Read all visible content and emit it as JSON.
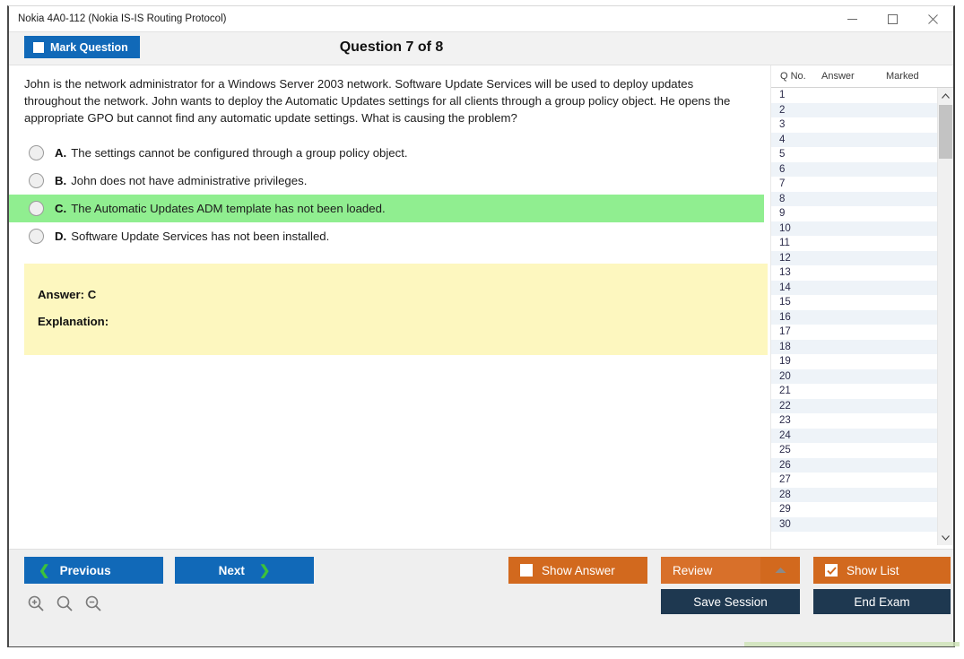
{
  "window": {
    "title": "Nokia 4A0-112 (Nokia IS-IS Routing Protocol)",
    "minimize_label": "minimize",
    "maximize_label": "maximize",
    "close_label": "close"
  },
  "header": {
    "mark_question_label": "Mark Question",
    "question_title": "Question 7 of 8"
  },
  "question": {
    "text": "John is the network administrator for a Windows Server 2003 network. Software Update Services will be used to deploy updates throughout the network. John wants to deploy the Automatic Updates settings for all clients through a group policy object. He opens the appropriate GPO but cannot find any automatic update settings. What is causing the problem?",
    "options": [
      {
        "letter": "A.",
        "text": "The settings cannot be configured through a group policy object.",
        "correct": false
      },
      {
        "letter": "B.",
        "text": "John does not have administrative privileges.",
        "correct": false
      },
      {
        "letter": "C.",
        "text": "The Automatic Updates ADM template has not been loaded.",
        "correct": true
      },
      {
        "letter": "D.",
        "text": "Software Update Services has not been installed.",
        "correct": false
      }
    ],
    "answer_line": "Answer: C",
    "explanation_line": "Explanation:"
  },
  "question_list": {
    "columns": [
      "Q No.",
      "Answer",
      "Marked"
    ],
    "rows": [
      {
        "no": "1",
        "answer": "",
        "marked": ""
      },
      {
        "no": "2",
        "answer": "",
        "marked": ""
      },
      {
        "no": "3",
        "answer": "",
        "marked": ""
      },
      {
        "no": "4",
        "answer": "",
        "marked": ""
      },
      {
        "no": "5",
        "answer": "",
        "marked": ""
      },
      {
        "no": "6",
        "answer": "",
        "marked": ""
      },
      {
        "no": "7",
        "answer": "",
        "marked": ""
      },
      {
        "no": "8",
        "answer": "",
        "marked": ""
      },
      {
        "no": "9",
        "answer": "",
        "marked": ""
      },
      {
        "no": "10",
        "answer": "",
        "marked": ""
      },
      {
        "no": "11",
        "answer": "",
        "marked": ""
      },
      {
        "no": "12",
        "answer": "",
        "marked": ""
      },
      {
        "no": "13",
        "answer": "",
        "marked": ""
      },
      {
        "no": "14",
        "answer": "",
        "marked": ""
      },
      {
        "no": "15",
        "answer": "",
        "marked": ""
      },
      {
        "no": "16",
        "answer": "",
        "marked": ""
      },
      {
        "no": "17",
        "answer": "",
        "marked": ""
      },
      {
        "no": "18",
        "answer": "",
        "marked": ""
      },
      {
        "no": "19",
        "answer": "",
        "marked": ""
      },
      {
        "no": "20",
        "answer": "",
        "marked": ""
      },
      {
        "no": "21",
        "answer": "",
        "marked": ""
      },
      {
        "no": "22",
        "answer": "",
        "marked": ""
      },
      {
        "no": "23",
        "answer": "",
        "marked": ""
      },
      {
        "no": "24",
        "answer": "",
        "marked": ""
      },
      {
        "no": "25",
        "answer": "",
        "marked": ""
      },
      {
        "no": "26",
        "answer": "",
        "marked": ""
      },
      {
        "no": "27",
        "answer": "",
        "marked": ""
      },
      {
        "no": "28",
        "answer": "",
        "marked": ""
      },
      {
        "no": "29",
        "answer": "",
        "marked": ""
      },
      {
        "no": "30",
        "answer": "",
        "marked": ""
      }
    ]
  },
  "toolbar": {
    "previous_label": "Previous",
    "next_label": "Next",
    "show_answer_label": "Show Answer",
    "review_label": "Review",
    "show_list_label": "Show List",
    "save_session_label": "Save Session",
    "end_exam_label": "End Exam",
    "zoom_in_label": "zoom-in",
    "zoom_reset_label": "zoom-reset",
    "zoom_out_label": "zoom-out"
  },
  "colors": {
    "primary_blue": "#1169b8",
    "orange": "#d2691e",
    "navy": "#1e3850",
    "correct_green": "#90ee90",
    "answer_yellow": "#fdf7bf",
    "chevron_green": "#3cc13c"
  }
}
